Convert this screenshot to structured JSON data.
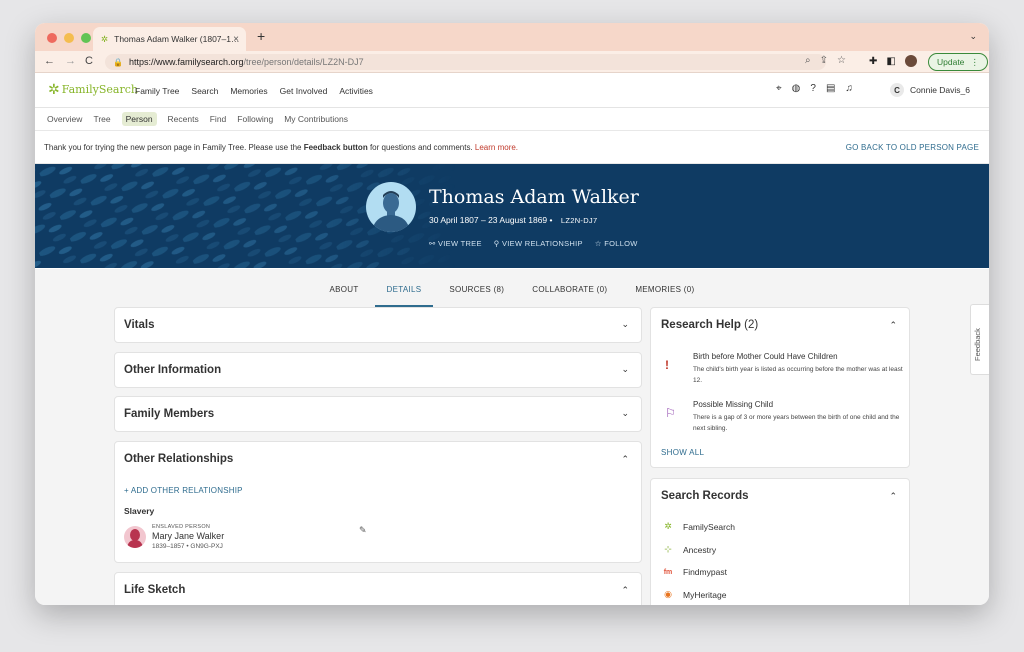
{
  "browser": {
    "tab_title": "Thomas Adam Walker (1807–1…",
    "tab_close": "×",
    "new_tab": "+",
    "tab_chevron": "⌄",
    "url_host": "https://www.familysearch.org",
    "url_path": "/tree/person/details/LZ2N-DJ7",
    "back": "←",
    "forward": "→",
    "reload": "C",
    "update_label": "Update",
    "traffic_colors": [
      "#ee6a5e",
      "#f4bd4f",
      "#61c454"
    ]
  },
  "header": {
    "logo": "FamilySearch",
    "menu": [
      "Family Tree",
      "Search",
      "Memories",
      "Get Involved",
      "Activities"
    ],
    "user_initial": "C",
    "user_name": "Connie Davis_6"
  },
  "subnav": [
    "Overview",
    "Tree",
    "Person",
    "Recents",
    "Find",
    "Following",
    "My Contributions"
  ],
  "banner": {
    "text_before": "Thank you for trying the new person page in Family Tree. Please use the ",
    "bold": "Feedback button",
    "text_after": " for questions and comments. ",
    "link": "Learn more.",
    "back_link": "GO BACK TO OLD PERSON PAGE"
  },
  "person": {
    "name": "Thomas Adam Walker",
    "dates": "30 April 1807 – 23 August 1869 •",
    "pid": "LZ2N-DJ7",
    "actions": [
      "VIEW TREE",
      "VIEW RELATIONSHIP",
      "FOLLOW"
    ]
  },
  "tabs": [
    {
      "label": "ABOUT"
    },
    {
      "label": "DETAILS",
      "active": true
    },
    {
      "label": "SOURCES (8)"
    },
    {
      "label": "COLLABORATE (0)"
    },
    {
      "label": "MEMORIES (0)"
    }
  ],
  "cards": {
    "vitals": "Vitals",
    "other_information": "Other Information",
    "family_members": "Family Members",
    "other_relationships": "Other Relationships",
    "add_other_relationship": "+ ADD OTHER RELATIONSHIP",
    "slavery": "Slavery",
    "rel_person": {
      "type": "ENSLAVED PERSON",
      "name": "Mary Jane Walker",
      "life": "1839–1857 •  GN9G-PXJ"
    },
    "life_sketch": "Life Sketch"
  },
  "research_help": {
    "title": "Research Help",
    "count": "(2)",
    "items": [
      {
        "title": "Birth before Mother Could Have Children",
        "desc": "The child's birth year is listed as occurring before the mother was at least 12."
      },
      {
        "title": "Possible Missing Child",
        "desc": "There is a gap of 3 or more years between the birth of one child and the next sibling."
      }
    ],
    "show_all": "SHOW ALL"
  },
  "search_records": {
    "title": "Search Records",
    "items": [
      "FamilySearch",
      "Ancestry",
      "Findmypast",
      "MyHeritage"
    ]
  },
  "feedback": "Feedback",
  "colors": {
    "hero": "#0f3b63",
    "link_blue": "#2f6c8e",
    "brand_green": "#87b52a",
    "alert_red": "#c0392b",
    "tab_bar": "#f6d7c9"
  }
}
